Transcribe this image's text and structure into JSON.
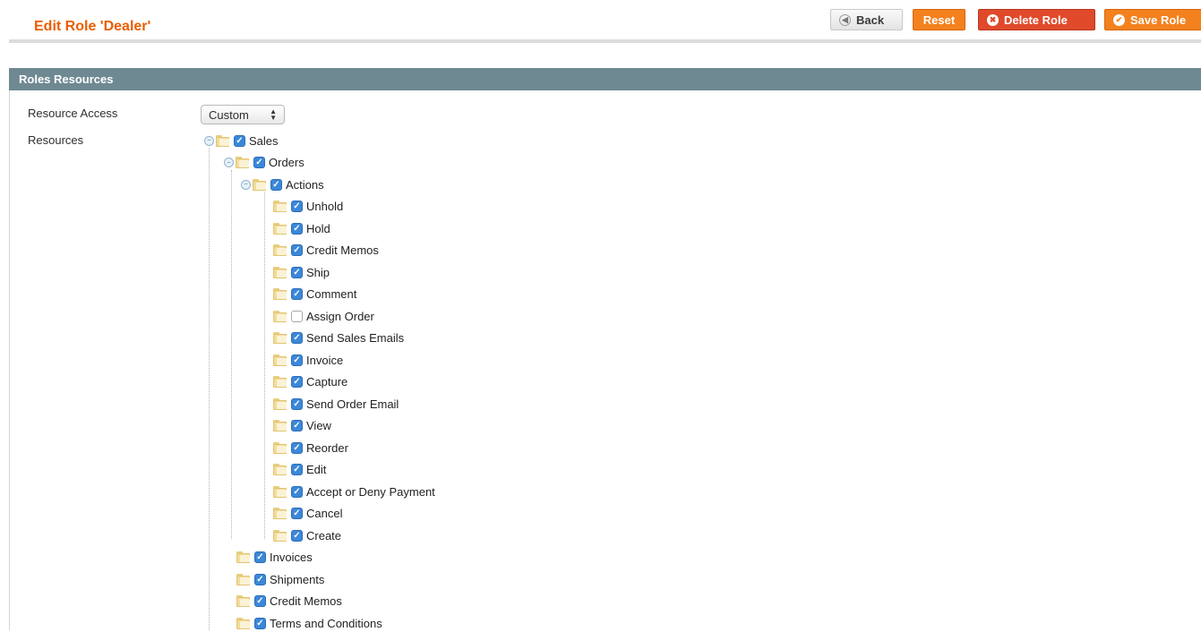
{
  "header": {
    "title": "Edit Role 'Dealer'",
    "buttons": {
      "back": "Back",
      "reset": "Reset",
      "delete": "Delete Role",
      "save": "Save Role"
    }
  },
  "section": {
    "title": "Roles Resources",
    "resource_access_label": "Resource Access",
    "resource_access_value": "Custom",
    "resources_label": "Resources"
  },
  "tree": {
    "sales": {
      "label": "Sales",
      "checked": true
    },
    "orders": {
      "label": "Orders",
      "checked": true
    },
    "actions": {
      "label": "Actions",
      "checked": true
    },
    "action_items": [
      {
        "label": "Unhold",
        "checked": true
      },
      {
        "label": "Hold",
        "checked": true
      },
      {
        "label": "Credit Memos",
        "checked": true
      },
      {
        "label": "Ship",
        "checked": true
      },
      {
        "label": "Comment",
        "checked": true
      },
      {
        "label": "Assign Order",
        "checked": false
      },
      {
        "label": "Send Sales Emails",
        "checked": true
      },
      {
        "label": "Invoice",
        "checked": true
      },
      {
        "label": "Capture",
        "checked": true
      },
      {
        "label": "Send Order Email",
        "checked": true
      },
      {
        "label": "View",
        "checked": true
      },
      {
        "label": "Reorder",
        "checked": true
      },
      {
        "label": "Edit",
        "checked": true
      },
      {
        "label": "Accept or Deny Payment",
        "checked": true
      },
      {
        "label": "Cancel",
        "checked": true
      },
      {
        "label": "Create",
        "checked": true
      }
    ],
    "sales_children": [
      {
        "label": "Invoices",
        "checked": true
      },
      {
        "label": "Shipments",
        "checked": true
      },
      {
        "label": "Credit Memos",
        "checked": true
      },
      {
        "label": "Terms and Conditions",
        "checked": true
      }
    ]
  },
  "colors": {
    "title_orange": "#eb5e00",
    "button_orange": "#f3811e",
    "delete_red": "#e04a2b",
    "section_header": "#6f8992",
    "checkbox_blue": "#3b87d9"
  }
}
